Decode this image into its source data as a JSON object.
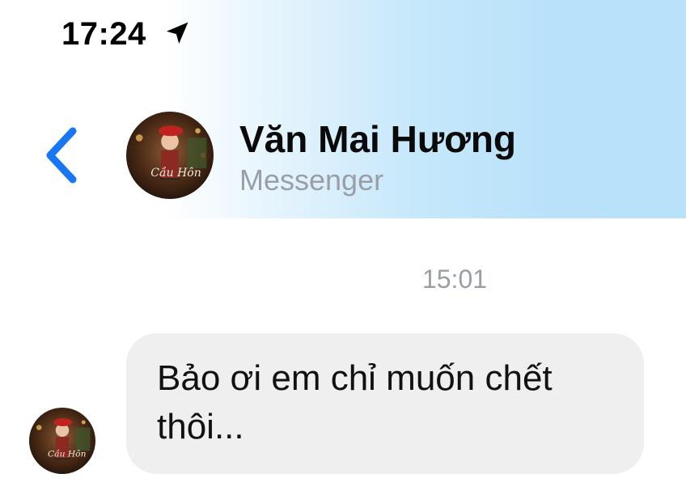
{
  "status_bar": {
    "time": "17:24",
    "location_icon": "location-arrow-icon"
  },
  "header": {
    "back_icon": "chevron-left-icon",
    "contact_name": "Văn Mai Hương",
    "subtitle": "Messenger",
    "avatar_caption": "Cầu Hôn"
  },
  "conversation": {
    "timestamp": "15:01",
    "messages": [
      {
        "text": "Bảo ơi em chỉ muốn chết thôi..."
      }
    ]
  },
  "colors": {
    "accent": "#1877f2",
    "header_gradient_end": "#b8e1fa",
    "bubble_bg": "#efefef",
    "muted_text": "#9a9ea6"
  }
}
